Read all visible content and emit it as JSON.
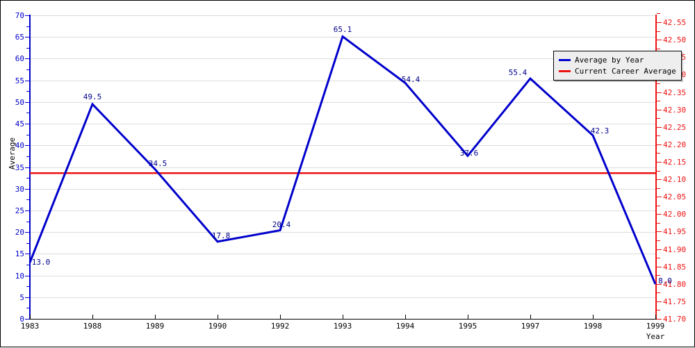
{
  "chart_data": {
    "type": "line",
    "title": "",
    "xlabel": "Year",
    "ylabel": "Average",
    "grid": true,
    "legend_position": "top-right",
    "categories": [
      "1983",
      "1988",
      "1989",
      "1990",
      "1992",
      "1993",
      "1994",
      "1995",
      "1997",
      "1998",
      "1999"
    ],
    "series": [
      {
        "name": "Average by Year",
        "color": "#0000cc",
        "values": [
          13.0,
          49.5,
          34.5,
          17.8,
          20.4,
          65.1,
          54.4,
          37.6,
          55.4,
          42.3,
          8.0
        ],
        "point_labels": [
          "13.0",
          "49.5",
          "34.5",
          "17.8",
          "20.4",
          "65.1",
          "54.4",
          "37.6",
          "55.4",
          "42.3",
          "8.0"
        ]
      },
      {
        "name": "Current Career Average",
        "color": "#ee1111",
        "type": "hline",
        "value": 33.6
      }
    ],
    "left_axis": {
      "color": "#0000cc",
      "ylim": [
        0,
        70
      ],
      "ticks": [
        0,
        5,
        10,
        15,
        20,
        25,
        30,
        35,
        40,
        45,
        50,
        55,
        60,
        65,
        70
      ],
      "tick_labels": [
        "0",
        "5",
        "10",
        "15",
        "20",
        "25",
        "30",
        "35",
        "40",
        "45",
        "50",
        "55",
        "60",
        "65",
        "70"
      ]
    },
    "right_axis": {
      "color": "#ee1111",
      "ylim": [
        41.7,
        42.57
      ],
      "ticks": [
        41.7,
        41.75,
        41.8,
        41.85,
        41.9,
        41.95,
        42.0,
        42.05,
        42.1,
        42.15,
        42.2,
        42.25,
        42.3,
        42.35,
        42.4,
        42.45,
        42.5,
        42.55
      ],
      "tick_labels": [
        "41.70",
        "41.75",
        "41.80",
        "41.85",
        "41.90",
        "41.95",
        "42.00",
        "42.05",
        "42.10",
        "42.15",
        "42.20",
        "42.25",
        "42.30",
        "42.35",
        "42.40",
        "42.45",
        "42.50",
        "42.55"
      ]
    }
  },
  "legend": {
    "entries": [
      {
        "label": "Average by Year",
        "color": "#0000cc"
      },
      {
        "label": "Current Career Average",
        "color": "#ee1111"
      }
    ]
  }
}
